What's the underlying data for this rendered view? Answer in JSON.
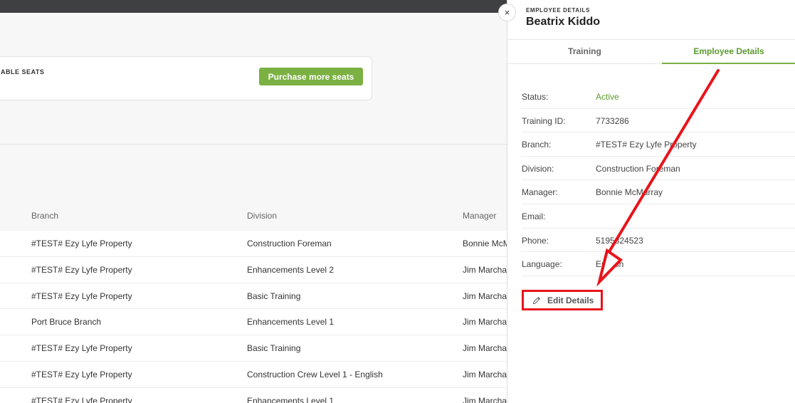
{
  "seats": {
    "label": "ABLE SEATS",
    "purchase_button": "Purchase more seats"
  },
  "table": {
    "headers": {
      "branch": "Branch",
      "division": "Division",
      "manager": "Manager"
    },
    "rows": [
      {
        "branch": "#TEST# Ezy Lyfe Property",
        "division": "Construction Foreman",
        "manager": "Bonnie McM"
      },
      {
        "branch": "#TEST# Ezy Lyfe Property",
        "division": "Enhancements Level 2",
        "manager": "Jim Marchar"
      },
      {
        "branch": "#TEST# Ezy Lyfe Property",
        "division": "Basic Training",
        "manager": "Jim Marchar"
      },
      {
        "branch": "Port Bruce Branch",
        "division": "Enhancements Level 1",
        "manager": "Jim Marchar"
      },
      {
        "branch": "#TEST# Ezy Lyfe Property",
        "division": "Basic Training",
        "manager": "Jim Marchar"
      },
      {
        "branch": "#TEST# Ezy Lyfe Property",
        "division": "Construction Crew Level 1 - English",
        "manager": "Jim Marchar"
      },
      {
        "branch": "#TEST# Ezy Lyfe Property",
        "division": "Enhancements Level 1",
        "manager": "Jim Marchar"
      }
    ]
  },
  "panel": {
    "close_icon": "×",
    "kicker": "EMPLOYEE DETAILS",
    "title": "Beatrix Kiddo",
    "tabs": {
      "training": "Training",
      "employee_details": "Employee Details"
    },
    "details": [
      {
        "label": "Status:",
        "value": "Active"
      },
      {
        "label": "Training ID:",
        "value": "7733286"
      },
      {
        "label": "Branch:",
        "value": "#TEST# Ezy Lyfe Property"
      },
      {
        "label": "Division:",
        "value": "Construction Foreman"
      },
      {
        "label": "Manager:",
        "value": "Bonnie McMurray"
      },
      {
        "label": "Email:",
        "value": ""
      },
      {
        "label": "Phone:",
        "value": "5195324523"
      },
      {
        "label": "Language:",
        "value": "English"
      }
    ],
    "edit_button": "Edit Details"
  },
  "colors": {
    "accent_green": "#7bb042",
    "active_green": "#5a9a2e",
    "annotation_red": "#e8141b",
    "topbar": "#3f4042"
  },
  "icons": {
    "close": "close-icon",
    "edit": "pencil-icon"
  }
}
